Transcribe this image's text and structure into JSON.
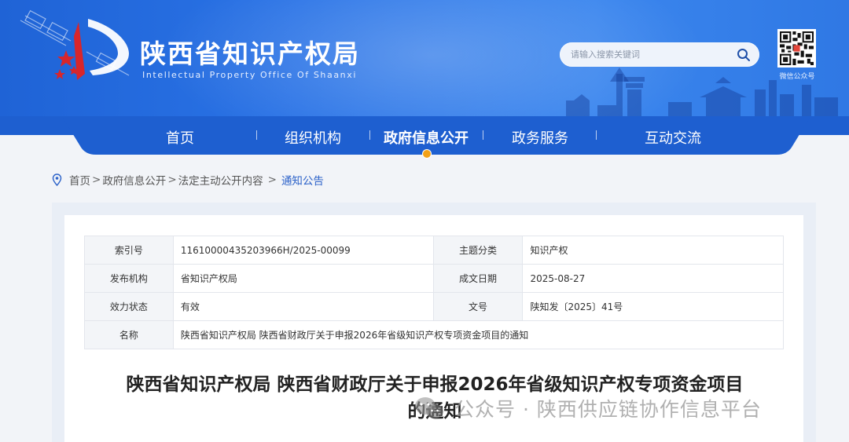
{
  "header": {
    "site_title": "陕西省知识产权局",
    "site_subtitle": "Intellectual Property Office Of Shaanxi",
    "search_placeholder": "请输入搜索关键词",
    "qr_label": "微信公众号"
  },
  "nav": {
    "items": [
      {
        "label": "首页",
        "active": false
      },
      {
        "label": "组织机构",
        "active": false
      },
      {
        "label": "政府信息公开",
        "active": true
      },
      {
        "label": "政务服务",
        "active": false
      },
      {
        "label": "互动交流",
        "active": false
      }
    ]
  },
  "breadcrumb": {
    "items": [
      "首页",
      "政府信息公开",
      "法定主动公开内容",
      "通知公告"
    ],
    "separator": ">"
  },
  "meta": {
    "rows": [
      {
        "k1": "索引号",
        "v1": "11610000435203966H/2025-00099",
        "k2": "主题分类",
        "v2": "知识产权"
      },
      {
        "k1": "发布机构",
        "v1": "省知识产权局",
        "k2": "成文日期",
        "v2": "2025-08-27"
      },
      {
        "k1": "效力状态",
        "v1": "有效",
        "k2": "文号",
        "v2": "陕知发〔2025〕41号"
      }
    ],
    "name_label": "名称",
    "name_value": "陕西省知识产权局 陕西省财政厅关于申报2026年省级知识产权专项资金项目的通知"
  },
  "doc": {
    "title_line1": "陕西省知识产权局 陕西省财政厅关于申报2026年省级知识产权专项资金项目",
    "title_line2": "的通知"
  },
  "watermark": {
    "text": "公众号 · 陕西供应链协作信息平台"
  },
  "colors": {
    "header_blue": "#2a73e6",
    "nav_blue": "#1e5fd0",
    "accent_orange": "#f2a118",
    "breadcrumb_current": "#2c62c9"
  }
}
